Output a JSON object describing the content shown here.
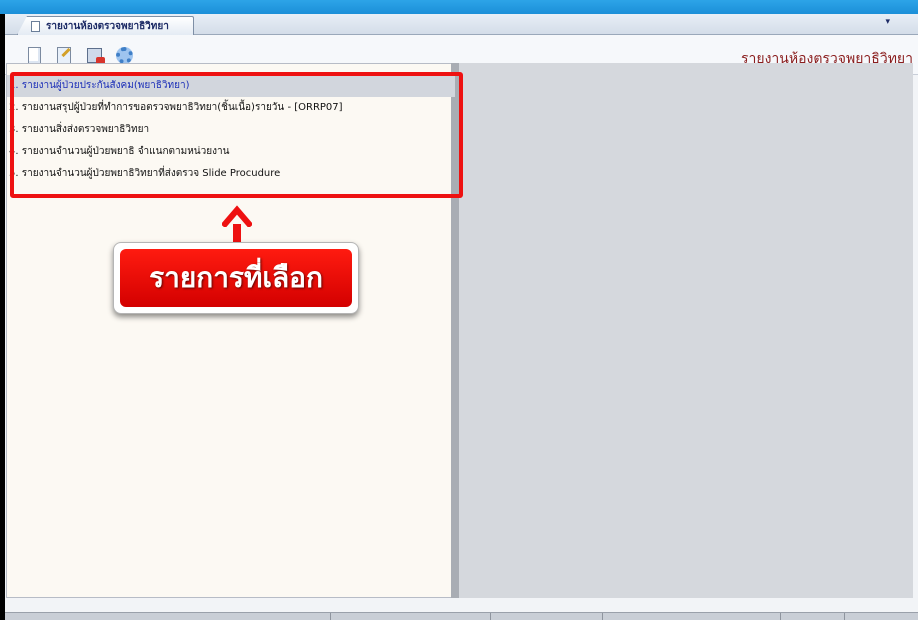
{
  "window": {
    "tab_label": "รายงานห้องตรวจพยาธิวิทยา",
    "tab_menu_arrow": "▾"
  },
  "toolbar": {
    "module_title": "รายงานห้องตรวจพยาธิวิทยา",
    "buttons": [
      {
        "icon": "new-document-icon"
      },
      {
        "icon": "edit-document-icon"
      },
      {
        "icon": "print-icon"
      },
      {
        "icon": "settings-gear-icon"
      }
    ]
  },
  "reports": {
    "selected_index": 0,
    "items": [
      "1. รายงานผู้ป่วยประกันสังคม(พยาธิวิทยา)",
      "2. รายงานสรุปผู้ป่วยที่ทำการขอตรวจพยาธิวิทยา(ชิ้นเนื้อ)รายวัน - [ORRP07]",
      "3. รายงานสิ่งส่งตรวจพยาธิวิทยา",
      "4. รายงานจำนวนผู้ป่วยพยาธิ จำแนกตามหน่วยงาน",
      "5. รายงานจำนวนผู้ป่วยพยาธิวิทยาที่ส่งตรวจ Slide Procudure"
    ]
  },
  "annotation": {
    "callout_text": "รายการที่เลือก",
    "color": "#ee1111"
  },
  "colors": {
    "header_strip": "#1b8fd8",
    "module_title": "#8a1d1d",
    "selected_text": "#1c2fb8"
  }
}
